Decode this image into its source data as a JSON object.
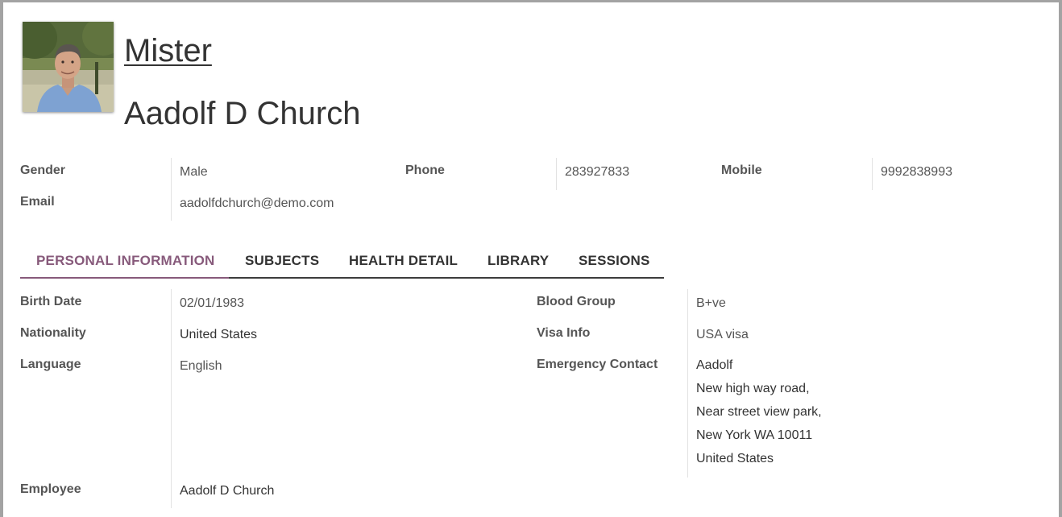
{
  "record": {
    "title_link": "Mister",
    "name": "Aadolf D Church"
  },
  "contact": {
    "gender_label": "Gender",
    "gender_value": "Male",
    "phone_label": "Phone",
    "phone_value": "283927833",
    "mobile_label": "Mobile",
    "mobile_value": "9992838993",
    "email_label": "Email",
    "email_value": "aadolfdchurch@demo.com"
  },
  "tabs": [
    {
      "label": "PERSONAL INFORMATION",
      "active": true
    },
    {
      "label": "SUBJECTS",
      "active": false
    },
    {
      "label": "HEALTH DETAIL",
      "active": false
    },
    {
      "label": "LIBRARY",
      "active": false
    },
    {
      "label": "SESSIONS",
      "active": false
    }
  ],
  "personal": {
    "birth_date_label": "Birth Date",
    "birth_date_value": "02/01/1983",
    "nationality_label": "Nationality",
    "nationality_value": "United States",
    "language_label": "Language",
    "language_value": "English",
    "blood_group_label": "Blood Group",
    "blood_group_value": "B+ve",
    "visa_label": "Visa Info",
    "visa_value": "USA visa",
    "emergency_label": "Emergency Contact",
    "emergency_lines": [
      "Aadolf",
      "New high way road,",
      "Near street view park,",
      "New York WA 10011",
      "United States"
    ],
    "employee_label": "Employee",
    "employee_value": "Aadolf D Church"
  },
  "colors": {
    "accent": "#875a7b",
    "tab_border": "#3c3c3c",
    "frame_border": "#a3a3a3"
  }
}
